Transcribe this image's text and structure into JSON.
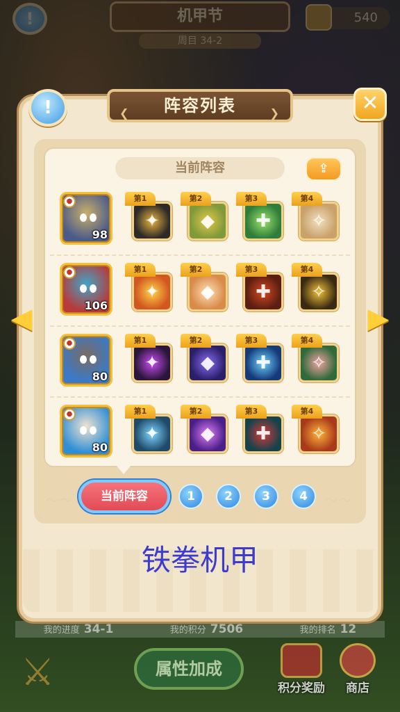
{
  "background": {
    "title": "机甲节",
    "subtitle": "周目 34-2",
    "currency": "540",
    "stats": [
      {
        "label": "我的进度",
        "value": "34-1"
      },
      {
        "label": "我的积分",
        "value": "7506"
      },
      {
        "label": "我的排名",
        "value": "12"
      }
    ],
    "attr_button": "属性加成",
    "reward_label": "积分奖励",
    "shop_label": "商店"
  },
  "dialog": {
    "title": "阵容列表",
    "info_icon": "info-icon",
    "close_icon": "close-icon",
    "close_glyph": "✕",
    "info_glyph": "!",
    "section_title": "当前阵容",
    "share_icon": "share-icon",
    "lineup_name": "铁拳机甲",
    "tabs": {
      "current": "当前阵容",
      "numbers": [
        "1",
        "2",
        "3",
        "4"
      ]
    },
    "rows": [
      {
        "hero": {
          "level": "98",
          "color": "#4a5a8a",
          "face": "#c9b06a"
        },
        "skills": [
          {
            "tag": "第1",
            "color": "#2d2a28",
            "accent": "#e9b440",
            "icon": "claw-slash-icon"
          },
          {
            "tag": "第2",
            "color": "#7f9a3a",
            "accent": "#e5c84a",
            "icon": "golden-shield-icon"
          },
          {
            "tag": "第3",
            "color": "#2e7d3a",
            "accent": "#9ee36c",
            "icon": "green-shield-icon"
          },
          {
            "tag": "第4",
            "color": "#c9a16b",
            "accent": "#f3e0c0",
            "icon": "stone-cleaver-icon"
          }
        ]
      },
      {
        "hero": {
          "level": "106",
          "color": "#b83a3a",
          "face": "#3fa6c8"
        },
        "skills": [
          {
            "tag": "第1",
            "color": "#d2561f",
            "accent": "#ffd34a",
            "icon": "fire-burst-icon"
          },
          {
            "tag": "第2",
            "color": "#d98b4a",
            "accent": "#ffe1b8",
            "icon": "creature-attack-icon"
          },
          {
            "tag": "第3",
            "color": "#5a1f12",
            "accent": "#d8481f",
            "icon": "fire-bowl-icon"
          },
          {
            "tag": "第4",
            "color": "#3a2a12",
            "accent": "#f2c13a",
            "icon": "golden-claw-icon"
          }
        ]
      },
      {
        "hero": {
          "level": "80",
          "color": "#3a7ac9",
          "face": "#7a6c62"
        },
        "skills": [
          {
            "tag": "第1",
            "color": "#2a163a",
            "accent": "#c84cf2",
            "icon": "purple-spark-icon"
          },
          {
            "tag": "第2",
            "color": "#2a1f6a",
            "accent": "#8a6cf2",
            "icon": "purple-vortex-icon"
          },
          {
            "tag": "第3",
            "color": "#143a7a",
            "accent": "#6fd2ff",
            "icon": "blue-comet-icon"
          },
          {
            "tag": "第4",
            "color": "#2f6a3a",
            "accent": "#f2a3a3",
            "icon": "flower-plant-icon"
          }
        ]
      },
      {
        "hero": {
          "level": "80",
          "color": "#2f8fd6",
          "face": "#f1e3cf"
        },
        "skills": [
          {
            "tag": "第1",
            "color": "#1f4a6a",
            "accent": "#7fd6ff",
            "icon": "ice-hammer-icon"
          },
          {
            "tag": "第2",
            "color": "#4a1f8a",
            "accent": "#e07ff2",
            "icon": "purple-target-icon"
          },
          {
            "tag": "第3",
            "color": "#16424a",
            "accent": "#d63a3a",
            "icon": "red-mask-icon"
          },
          {
            "tag": "第4",
            "color": "#a83a1a",
            "accent": "#ffb43a",
            "icon": "fist-icon"
          }
        ]
      }
    ]
  }
}
